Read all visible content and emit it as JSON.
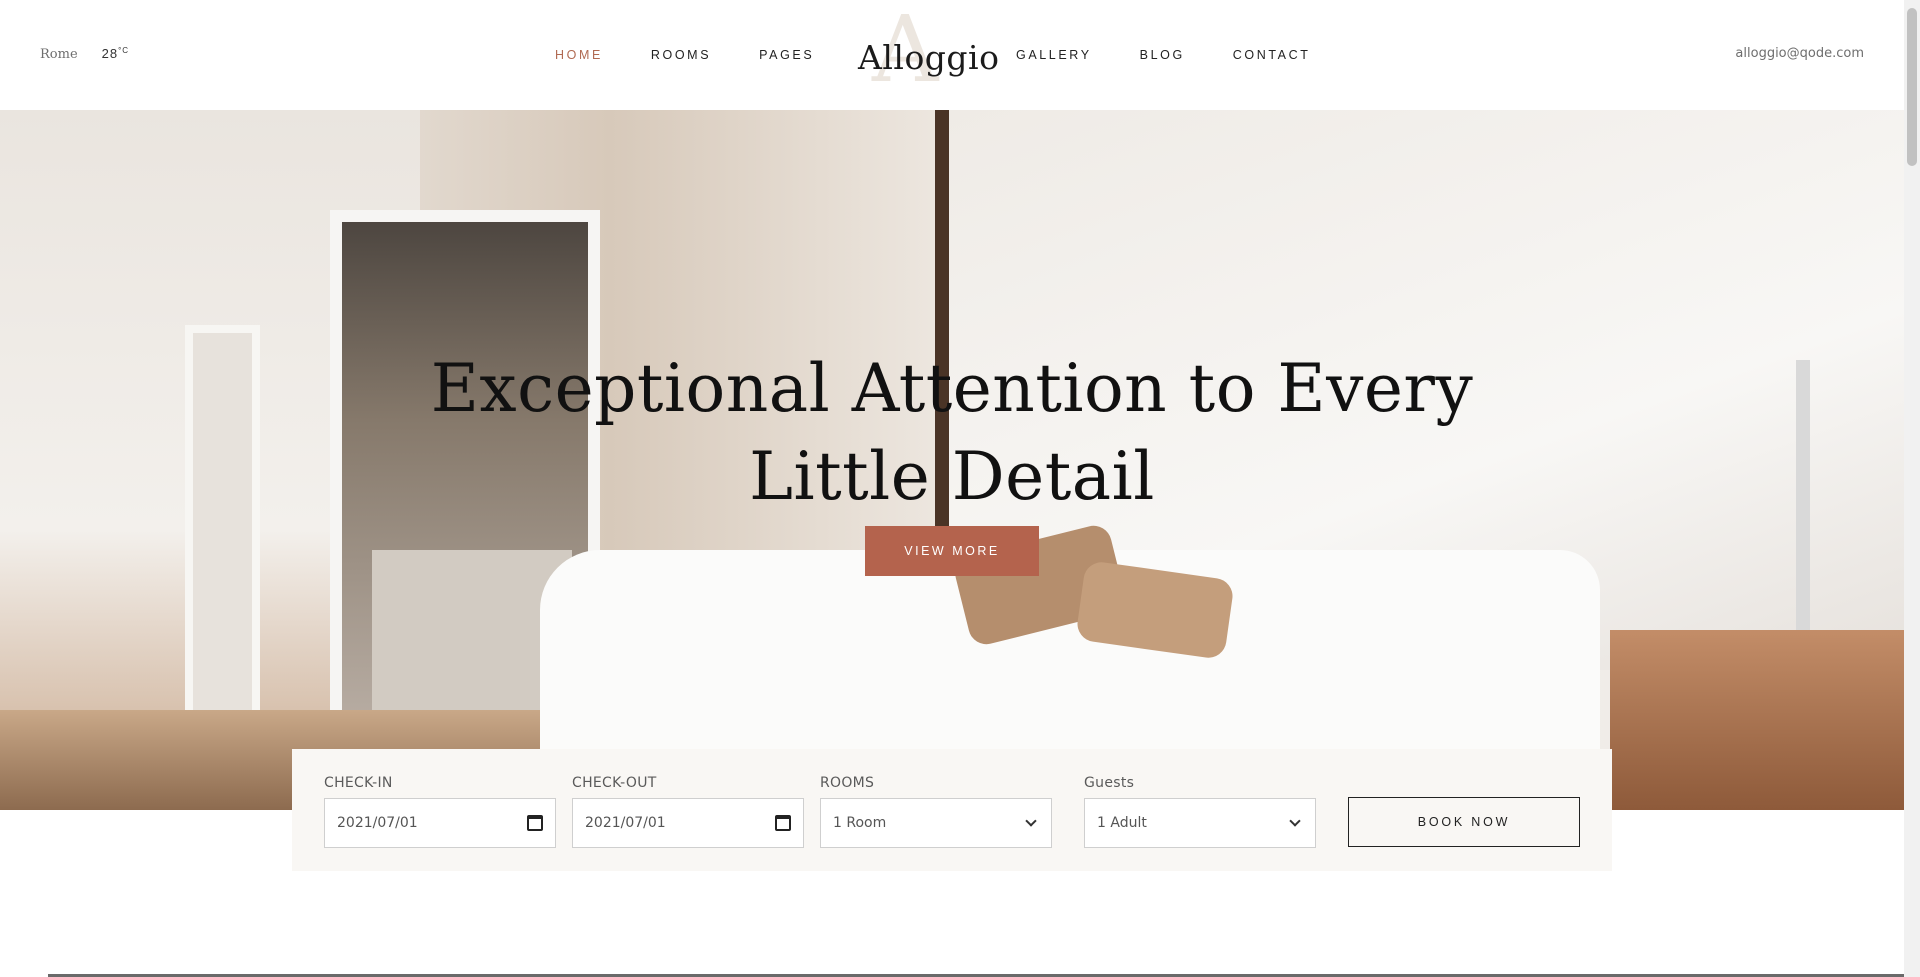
{
  "header": {
    "city": "Rome",
    "temperature": "28",
    "temperature_unit": "°C",
    "logo_text": "Alloggio",
    "logo_mark": "A",
    "email": "alloggio@qode.com",
    "nav_left": [
      "HOME",
      "ROOMS",
      "PAGES"
    ],
    "nav_right": [
      "GALLERY",
      "BLOG",
      "CONTACT"
    ],
    "active_nav": "HOME"
  },
  "hero": {
    "title_line1": "Exceptional Attention to Every",
    "title_line2": "Little Detail",
    "button_label": "VIEW MORE"
  },
  "booking": {
    "checkin_label": "CHECK-IN",
    "checkin_value": "2021/07/01",
    "checkout_label": "CHECK-OUT",
    "checkout_value": "2021/07/01",
    "rooms_label": "ROOMS",
    "rooms_value": "1 Room",
    "guests_label": "Guests",
    "guests_value": "1 Adult",
    "book_label": "BOOK NOW"
  },
  "colors": {
    "accent": "#b4634d",
    "active_nav": "#b06a52",
    "booking_bg": "#f9f7f4"
  }
}
